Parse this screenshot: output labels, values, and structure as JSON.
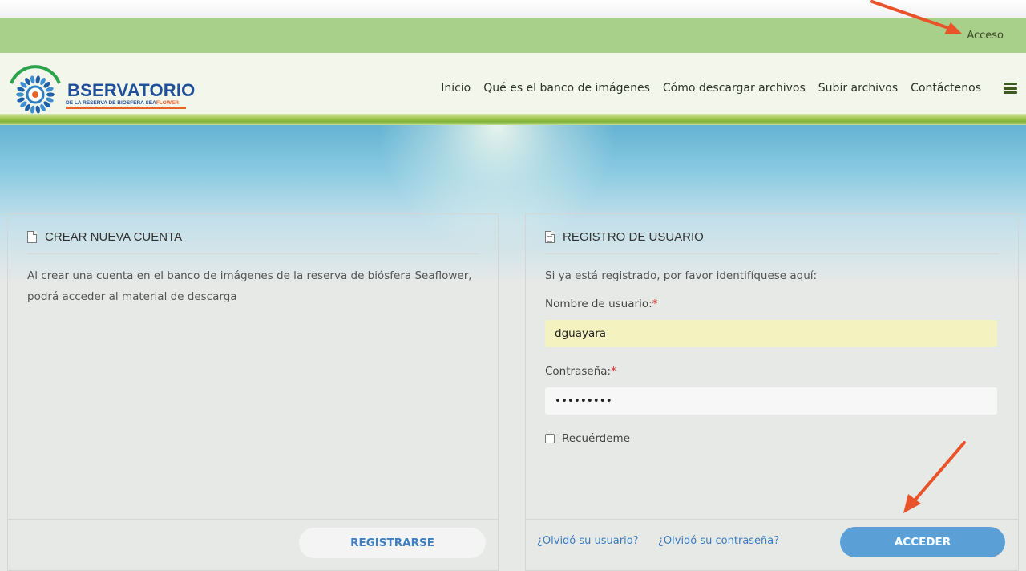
{
  "topbar": {
    "access_link": "Acceso"
  },
  "logo": {
    "title": "BSERVATORIO",
    "subtitle_main": "DE LA RESERVA DE BIOSFERA SEA",
    "subtitle_accent": "FLOWER"
  },
  "nav": {
    "items": [
      {
        "label": "Inicio"
      },
      {
        "label": "Qué es el banco de imágenes"
      },
      {
        "label": "Cómo descargar archivos"
      },
      {
        "label": "Subir archivos"
      },
      {
        "label": "Contáctenos"
      }
    ]
  },
  "create_account": {
    "title": "CREAR NUEVA CUENTA",
    "description": "Al crear una cuenta en el banco de imágenes de la reserva de biósfera Seaflower, podrá acceder al material de descarga",
    "register_button": "REGISTRARSE"
  },
  "login": {
    "title": "REGISTRO DE USUARIO",
    "intro": "Si ya está registrado, por favor identifíquese aquí:",
    "username_label": "Nombre de usuario:",
    "username_value": "dguayara",
    "password_label": "Contraseña:",
    "password_value": "•••••••••",
    "required_mark": "*",
    "remember_label": "Recuérdeme",
    "remember_checked": false,
    "forgot_user": "¿Olvidó su usuario?",
    "forgot_password": "¿Olvidó su contraseña?",
    "submit_button": "ACCEDER"
  },
  "colors": {
    "access_bar": "#a8d08a",
    "primary_button": "#5a9fd6",
    "link": "#3b7cbf",
    "annotation_arrow": "#e8532a"
  }
}
